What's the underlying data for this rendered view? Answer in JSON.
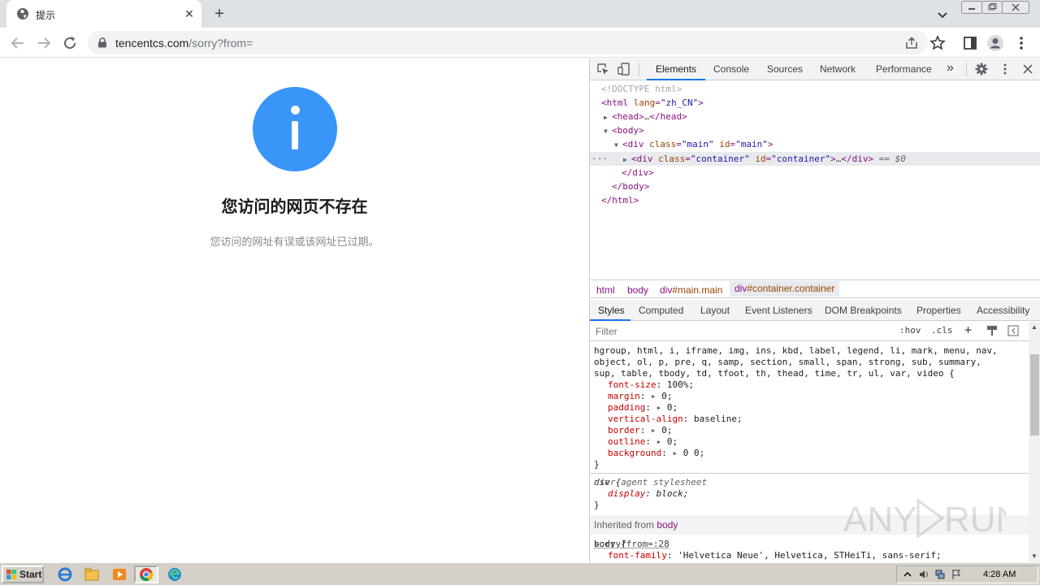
{
  "browser": {
    "tab_title": "提示",
    "tab_close_glyph": "✕",
    "new_tab_glyph": "+",
    "url_host": "tencentcs.com",
    "url_path": "/sorry?from="
  },
  "page": {
    "icon": "info-icon",
    "title": "您访问的网页不存在",
    "description": "您访问的网址有误或该网址已过期。",
    "accent_color": "#3a95f9"
  },
  "devtools": {
    "tabs": [
      "Elements",
      "Console",
      "Sources",
      "Network",
      "Performance"
    ],
    "more_tabs_glyph": "»",
    "dom": {
      "doctype": "<!DOCTYPE html>",
      "html_open": "html",
      "html_lang_attr": "lang",
      "html_lang_val": "\"zh_CN\"",
      "head": "head",
      "body": "body",
      "div_main": "div",
      "class_attr": "class",
      "main_class_val": "\"main\"",
      "id_attr": "id",
      "main_id_val": "\"main\"",
      "div_container": "div",
      "container_class_val": "\"container\"",
      "container_id_val": "\"container\"",
      "ellipsis": "…",
      "selected_marker": "== $0",
      "row_menu": "···",
      "close_div": "</div>",
      "close_body": "</body>",
      "close_html": "</html>"
    },
    "breadcrumbs": [
      {
        "tag": "html",
        "cls": ""
      },
      {
        "tag": "body",
        "cls": ""
      },
      {
        "tag": "div",
        "cls": "#main.main"
      },
      {
        "tag": "div",
        "cls": "#container.container"
      }
    ],
    "sub_tabs": [
      "Styles",
      "Computed",
      "Layout",
      "Event Listeners",
      "DOM Breakpoints",
      "Properties",
      "Accessibility"
    ],
    "filter_placeholder": "Filter",
    "filter_hov": ":hov",
    "filter_cls": ".cls",
    "filter_plus": "+",
    "styles": {
      "selector_line1": "hgroup, html, i, iframe, img, ins, kbd, label, legend, li, mark, menu, nav,",
      "selector_line2": "object, ol, p, pre, q, samp, section, small, span, strong, sub, summary,",
      "selector_line3": "sup, table, tbody, td, tfoot, th, thead, time, tr, ul, var, video {",
      "decls": [
        {
          "prop": "font-size",
          "val": "100%;",
          "arrow": false
        },
        {
          "prop": "margin",
          "val": "0;",
          "arrow": true
        },
        {
          "prop": "padding",
          "val": "0;",
          "arrow": true
        },
        {
          "prop": "vertical-align",
          "val": "baseline;",
          "arrow": false
        },
        {
          "prop": "border",
          "val": "0;",
          "arrow": true
        },
        {
          "prop": "outline",
          "val": "0;",
          "arrow": true
        },
        {
          "prop": "background",
          "val": "0 0;",
          "arrow": true
        }
      ],
      "close_brace": "}",
      "div_selector": "div {",
      "div_source": "user agent stylesheet",
      "div_prop": "display",
      "div_val": "block;",
      "inherited_label": "Inherited from",
      "inherited_tag": "body",
      "body_selector": "body {",
      "body_source": "sorry?from=:28",
      "body_prop": "font-family",
      "body_val": "'Helvetica Neue', Helvetica, STHeiTi, sans-serif;"
    }
  },
  "taskbar": {
    "start_label": "Start",
    "clock": "4:28 AM"
  },
  "watermark": "ANY RUN"
}
